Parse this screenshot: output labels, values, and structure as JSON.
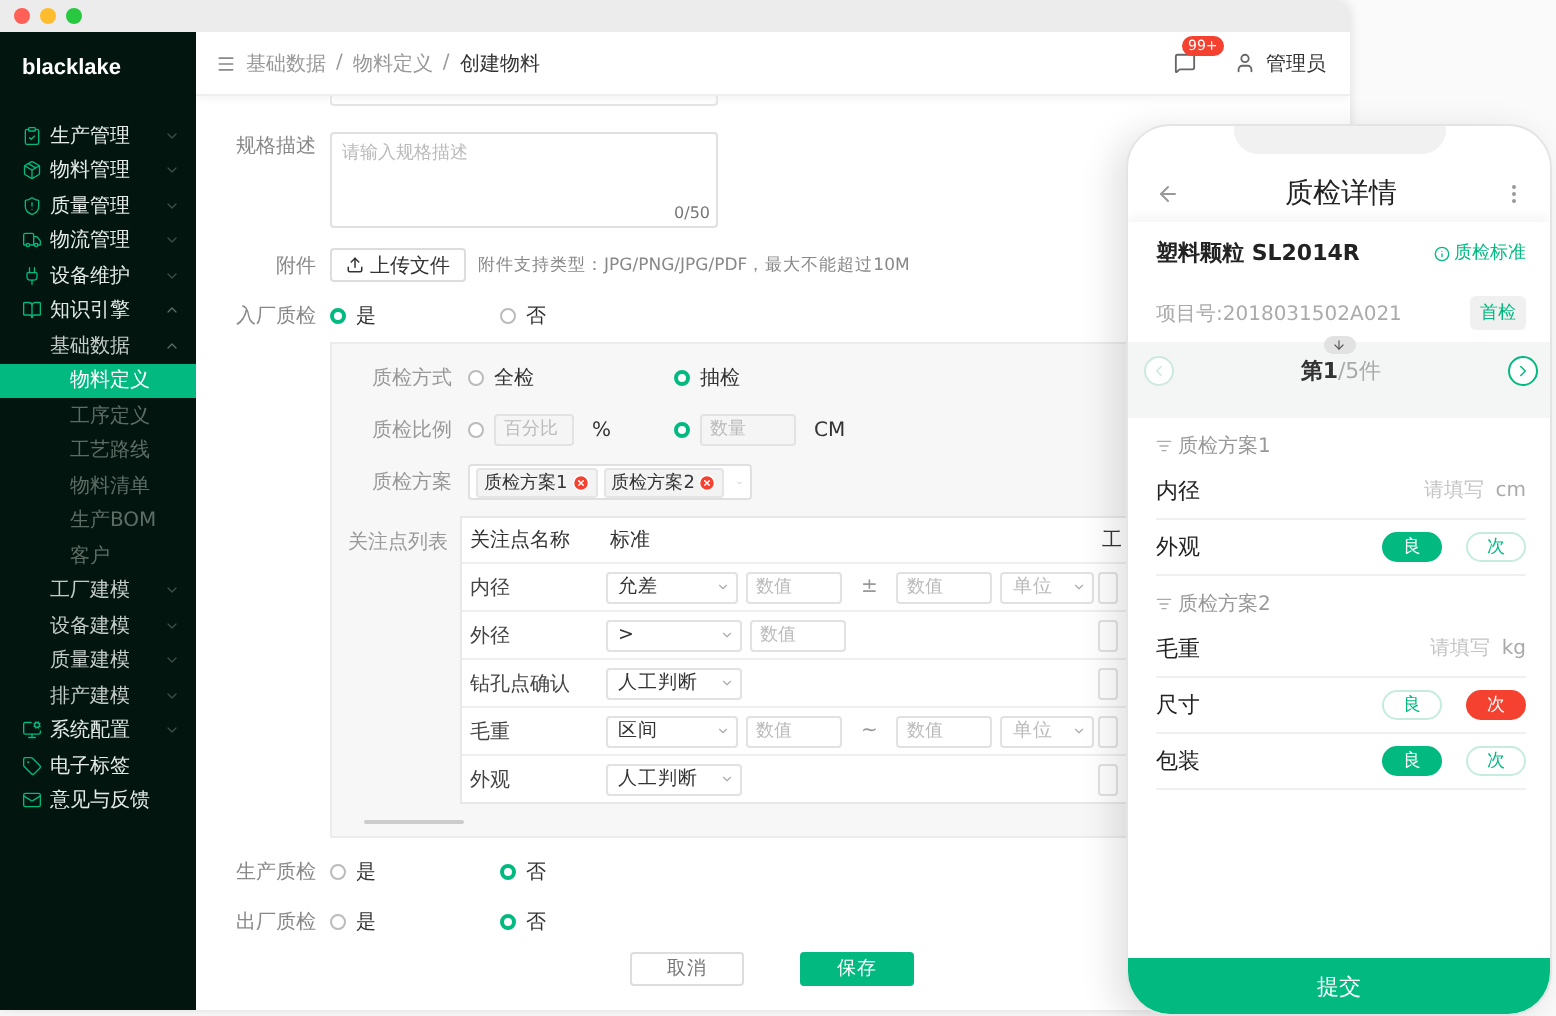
{
  "sidebar": {
    "logo": "blacklake",
    "items": [
      {
        "label": "生产管理",
        "selected": false,
        "expanded": false
      },
      {
        "label": "物料管理",
        "selected": false,
        "expanded": false
      },
      {
        "label": "质量管理",
        "selected": false,
        "expanded": false
      },
      {
        "label": "物流管理",
        "selected": false,
        "expanded": false
      },
      {
        "label": "设备维护",
        "selected": false,
        "expanded": false
      },
      {
        "label": "知识引擎",
        "selected": false,
        "expanded": true,
        "children": [
          {
            "label": "基础数据",
            "selected": false,
            "expanded": true,
            "children": [
              {
                "label": "物料定义",
                "selected": true
              },
              {
                "label": "工序定义",
                "selected": false
              },
              {
                "label": "工艺路线",
                "selected": false
              },
              {
                "label": "物料清单",
                "selected": false
              },
              {
                "label": "生产BOM",
                "selected": false
              },
              {
                "label": "客户",
                "selected": false
              }
            ]
          },
          {
            "label": "工厂建模",
            "selected": false,
            "expanded": false
          },
          {
            "label": "设备建模",
            "selected": false,
            "expanded": false
          },
          {
            "label": "质量建模",
            "selected": false,
            "expanded": false
          },
          {
            "label": "排产建模",
            "selected": false,
            "expanded": false
          }
        ]
      },
      {
        "label": "系统配置",
        "selected": false,
        "expanded": false
      },
      {
        "label": "电子标签",
        "selected": false
      },
      {
        "label": "意见与反馈",
        "selected": false
      }
    ]
  },
  "header": {
    "breadcrumb": {
      "items": [
        "基础数据",
        "物料定义",
        "创建物料"
      ],
      "separator": "/"
    },
    "notification_count": "99+",
    "user": "管理员"
  },
  "form": {
    "spec": {
      "label": "规格描述",
      "placeholder": "请输入规格描述",
      "counter": "0/50"
    },
    "attachment": {
      "label": "附件",
      "button": "上传文件",
      "hint": "附件支持类型：JPG/PNG/JPG/PDF，最大不能超过10M"
    },
    "incoming_qc": {
      "label": "入厂质检",
      "options": [
        {
          "label": "是",
          "selected": true
        },
        {
          "label": "否",
          "selected": false
        }
      ]
    },
    "qc_panel": {
      "method": {
        "label": "质检方式",
        "options": [
          {
            "label": "全检",
            "selected": false
          },
          {
            "label": "抽检",
            "selected": true
          }
        ]
      },
      "ratio": {
        "label": "质检比例",
        "options": [
          {
            "placeholder": "百分比",
            "unit": "%",
            "selected": false
          },
          {
            "placeholder": "数量",
            "unit": "CM",
            "selected": true
          }
        ]
      },
      "plan": {
        "label": "质检方案",
        "tags": [
          "质检方案1",
          "质检方案2"
        ]
      },
      "points": {
        "label": "关注点列表",
        "columns": [
          "关注点名称",
          "标准",
          "工"
        ],
        "rows": [
          {
            "name": "内径",
            "kind": "range",
            "standard": "允差",
            "value_placeholders": [
              "数值",
              "数值"
            ],
            "separator": "±",
            "unit_placeholder": "单位"
          },
          {
            "name": "外径",
            "kind": "single",
            "standard": ">",
            "value_placeholders": [
              "数值"
            ]
          },
          {
            "name": "钻孔点确认",
            "kind": "judge",
            "standard": "人工判断"
          },
          {
            "name": "毛重",
            "kind": "range",
            "standard": "区间",
            "value_placeholders": [
              "数值",
              "数值"
            ],
            "separator": "~",
            "unit_placeholder": "单位"
          },
          {
            "name": "外观",
            "kind": "judge",
            "standard": "人工判断"
          }
        ]
      }
    },
    "production_qc": {
      "label": "生产质检",
      "options": [
        {
          "label": "是",
          "selected": false
        },
        {
          "label": "否",
          "selected": true
        }
      ]
    },
    "outgoing_qc": {
      "label": "出厂质检",
      "options": [
        {
          "label": "是",
          "selected": false
        },
        {
          "label": "否",
          "selected": true
        }
      ]
    },
    "buttons": [
      {
        "label": "取消",
        "kind": "secondary"
      },
      {
        "label": "保存",
        "kind": "primary"
      }
    ]
  },
  "phone": {
    "title": "质检详情",
    "product": "塑料颗粒 SL2014R",
    "standard_link": "质检标准",
    "project_no": "项目号:2018031502A021",
    "badge": "首检",
    "pager": "**第1**/5件",
    "sections": [
      {
        "title": "质检方案1",
        "items": [
          {
            "kind": "input",
            "label": "内径",
            "placeholder": "请填写",
            "unit": "cm"
          },
          {
            "kind": "choice",
            "label": "外观",
            "options": [
              {
                "label": "良",
                "selected": true
              },
              {
                "label": "次",
                "selected": false
              }
            ]
          }
        ]
      },
      {
        "title": "质检方案2",
        "items": [
          {
            "kind": "input",
            "label": "毛重",
            "placeholder": "请填写",
            "unit": "kg"
          },
          {
            "kind": "choice",
            "label": "尺寸",
            "options": [
              {
                "label": "良",
                "selected": false
              },
              {
                "label": "次",
                "selected": true
              }
            ]
          },
          {
            "kind": "choice",
            "label": "包装",
            "options": [
              {
                "label": "良",
                "selected": true
              },
              {
                "label": "次",
                "selected": false
              }
            ]
          }
        ]
      }
    ],
    "submit": "提交"
  }
}
